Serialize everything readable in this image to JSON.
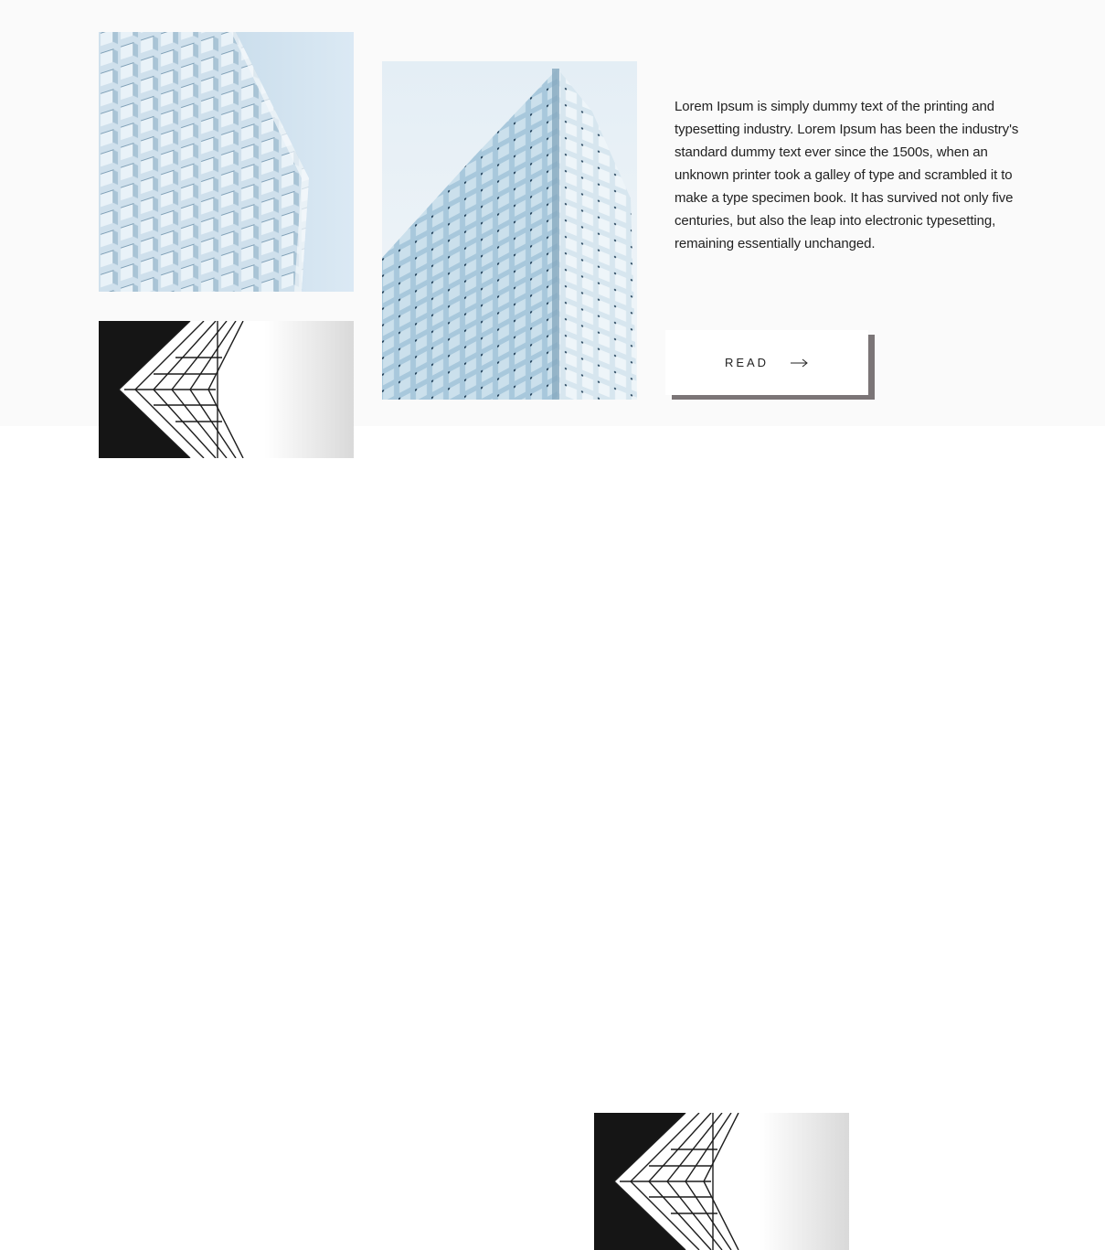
{
  "intro": {
    "paragraph": "Lorem Ipsum is simply dummy text of the printing and typesetting industry. Lorem Ipsum has been the industry's standard dummy text ever since the 1500s, when an unknown printer took a galley of type and scrambled it to make a type specimen book. It has survived not only five centuries, but also the leap into electronic typesetting, remaining essentially unchanged.",
    "read_button": {
      "label": "READ",
      "icon": "arrow-right-icon"
    }
  },
  "images": [
    {
      "name": "glass-facade-image",
      "subject": "glass building facade"
    },
    {
      "name": "glass-tower-corner-image",
      "subject": "glass tower corner"
    },
    {
      "name": "mirrored-skyscraper-image",
      "subject": "mirrored skyscraper against dark sky"
    },
    {
      "name": "mirrored-skyscraper-image-repeat",
      "subject": "mirrored skyscraper against dark sky"
    }
  ],
  "colors": {
    "band_background": "#fafafa",
    "button_shadow": "#7b7577",
    "text": "#222222"
  }
}
